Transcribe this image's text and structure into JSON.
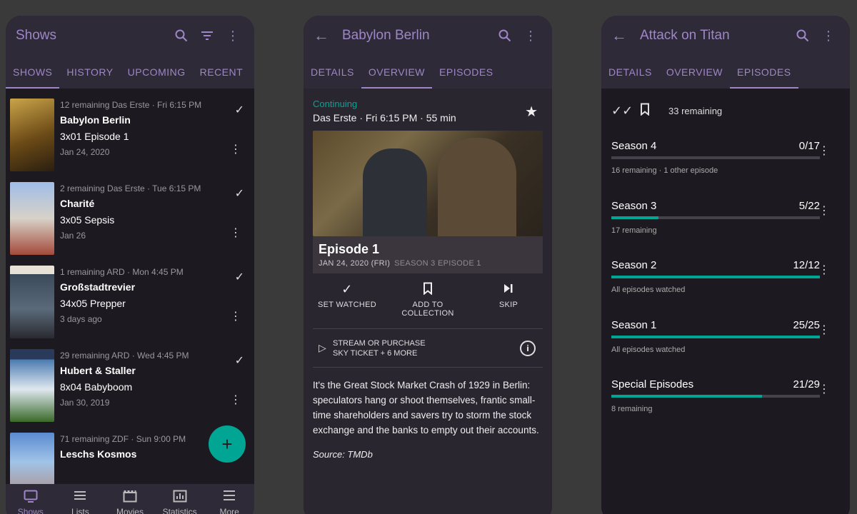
{
  "phone1": {
    "title": "Shows",
    "tabs": [
      "SHOWS",
      "HISTORY",
      "UPCOMING",
      "RECENT"
    ],
    "shows": [
      {
        "meta": "12 remaining  Das Erste · Fri 6:15 PM",
        "name": "Babylon Berlin",
        "episode": "3x01 Episode 1",
        "date": "Jan 24, 2020",
        "poster_color": "#a07a2a"
      },
      {
        "meta": "2 remaining  Das Erste · Tue 6:15 PM",
        "name": "Charité",
        "episode": "3x05 Sepsis",
        "date": "Jan 26",
        "poster_color": "#5a7cc0"
      },
      {
        "meta": "1 remaining  ARD · Mon 4:45 PM",
        "name": "Großstadtrevier",
        "episode": "34x05 Prepper",
        "date": "3 days ago",
        "poster_color": "#3f5a6a"
      },
      {
        "meta": "29 remaining  ARD · Wed 4:45 PM",
        "name": "Hubert & Staller",
        "episode": "8x04 Babyboom",
        "date": "Jan 30, 2019",
        "poster_color": "#3f6a8a"
      },
      {
        "meta": "71 remaining  ZDF · Sun 9:00 PM",
        "name": "Leschs Kosmos",
        "episode": "",
        "date": "",
        "poster_color": "#4a78b0"
      }
    ],
    "fab_label": "+",
    "bottom_nav": [
      {
        "label": "Shows",
        "icon": "tv-icon"
      },
      {
        "label": "Lists",
        "icon": "list-icon"
      },
      {
        "label": "Movies",
        "icon": "movie-icon"
      },
      {
        "label": "Statistics",
        "icon": "chart-icon"
      },
      {
        "label": "More",
        "icon": "menu-icon"
      }
    ]
  },
  "phone2": {
    "title": "Babylon Berlin",
    "tabs": [
      "DETAILS",
      "OVERVIEW",
      "EPISODES"
    ],
    "status": "Continuing",
    "network": "Das Erste · Fri 6:15 PM · 55 min",
    "episode_title": "Episode 1",
    "episode_date": "JAN 24, 2020 (FRI)",
    "episode_number": "SEASON 3 EPISODE 1",
    "actions": {
      "watched": "SET WATCHED",
      "collection_line1": "ADD TO",
      "collection_line2": "COLLECTION",
      "skip": "SKIP"
    },
    "stream_line1": "STREAM OR PURCHASE",
    "stream_line2": "SKY TICKET + 6 MORE",
    "description": "It's the Great Stock Market Crash of 1929 in Berlin: speculators hang or shoot themselves, frantic small-time shareholders and savers try to storm the stock exchange and the banks to empty out their accounts.",
    "source": "Source: TMDb"
  },
  "phone3": {
    "title": "Attack on Titan",
    "tabs": [
      "DETAILS",
      "OVERVIEW",
      "EPISODES"
    ],
    "remaining": "33 remaining",
    "seasons": [
      {
        "name": "Season 4",
        "count": "0/17",
        "progress": 0.0,
        "note": "16 remaining · 1 other episode"
      },
      {
        "name": "Season 3",
        "count": "5/22",
        "progress": 0.227,
        "note": "17 remaining"
      },
      {
        "name": "Season 2",
        "count": "12/12",
        "progress": 1.0,
        "note": "All episodes watched"
      },
      {
        "name": "Season 1",
        "count": "25/25",
        "progress": 1.0,
        "note": "All episodes watched"
      },
      {
        "name": "Special Episodes",
        "count": "21/29",
        "progress": 0.724,
        "note": "8 remaining"
      }
    ]
  }
}
